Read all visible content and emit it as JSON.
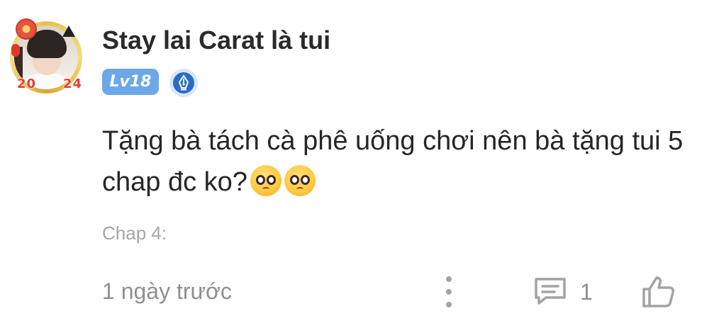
{
  "comment": {
    "username": "Stay lai Carat là tui",
    "level": "Lv18",
    "text": "Tặng bà tách cà phê uống chơi nên bà tặng tui 5 chap đc ko?",
    "emojis": [
      "pleading-face",
      "pleading-face"
    ],
    "chapter": "Chap 4:",
    "timestamp": "1 ngày trước",
    "reply_count": "1",
    "avatar_frame_year": [
      "20",
      "24"
    ]
  },
  "icons": {
    "more": "vertical-dots-icon",
    "reply": "comment-bubble-icon",
    "like": "thumbs-up-icon",
    "badge": "pen-nib-badge-icon"
  },
  "colors": {
    "level_badge": "#6ca8e8",
    "pen_badge": "#2b6bc4",
    "muted_text": "#8f8f8f",
    "frame_year": "#e2402f"
  }
}
